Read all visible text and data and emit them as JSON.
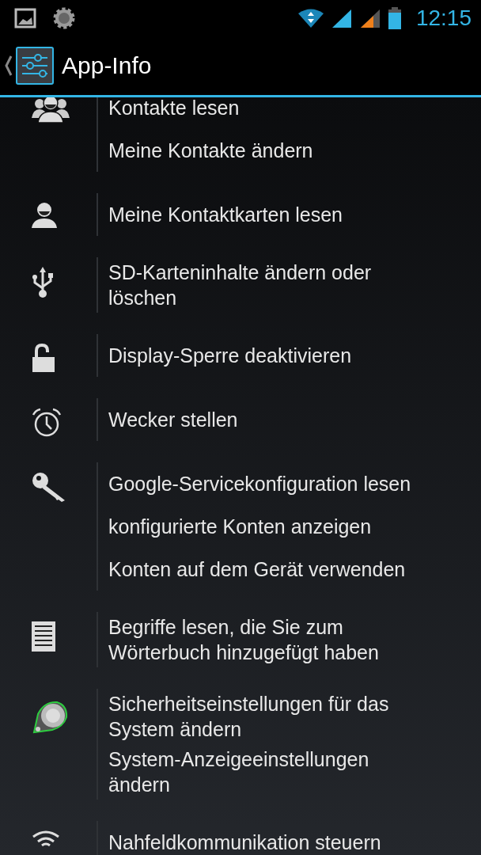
{
  "status_bar": {
    "time": "12:15"
  },
  "action_bar": {
    "title": "App-Info"
  },
  "permission_groups": [
    {
      "kind": "people",
      "items": [
        "Kontakte lesen",
        "Meine Kontakte ändern"
      ]
    },
    {
      "kind": "person",
      "items": [
        "Meine Kontaktkarten lesen"
      ]
    },
    {
      "kind": "usb",
      "items": [
        "SD-Karteninhalte ändern oder löschen"
      ]
    },
    {
      "kind": "lock",
      "items": [
        "Display-Sperre deaktivieren"
      ]
    },
    {
      "kind": "alarm",
      "items": [
        "Wecker stellen"
      ]
    },
    {
      "kind": "key",
      "items": [
        "Google-Servicekonfiguration lesen",
        "konfigurierte Konten anzeigen",
        "Konten auf dem Gerät verwenden"
      ]
    },
    {
      "kind": "document",
      "items": [
        "Begriffe lesen, die Sie zum Wörterbuch hinzugefügt haben"
      ]
    },
    {
      "kind": "app",
      "items": [
        "Sicherheitseinstellungen für das System ändern",
        "System-Anzeigeeinstellungen ändern"
      ]
    },
    {
      "kind": "wireless",
      "items": [
        "Nahfeldkommunikation steuern"
      ]
    }
  ]
}
